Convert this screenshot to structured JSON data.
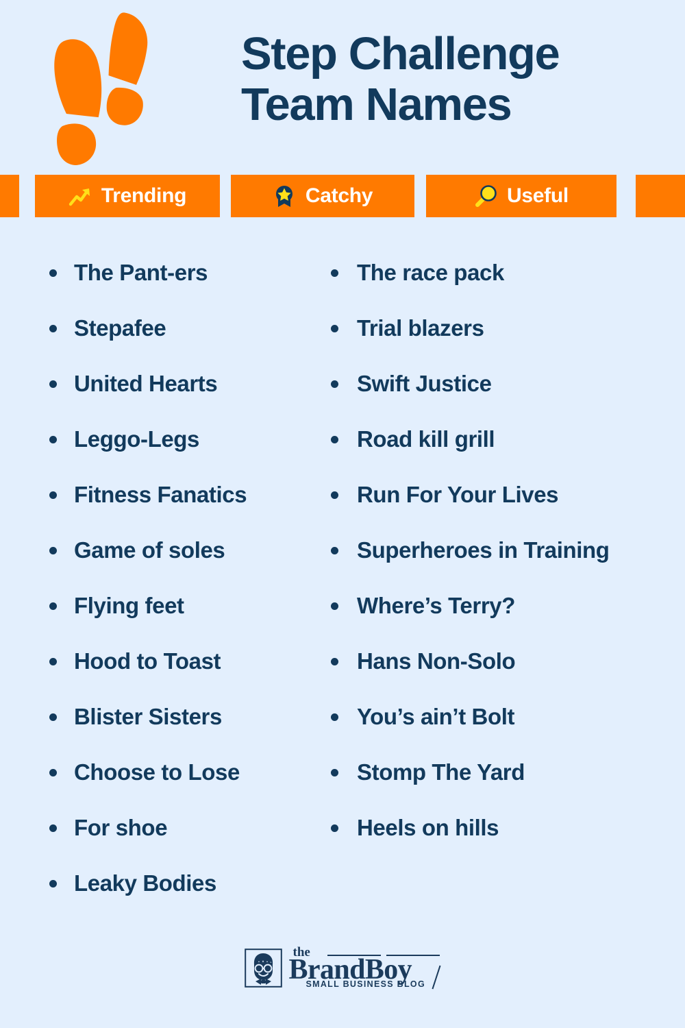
{
  "theme": {
    "background": "#e3effd",
    "navy": "#123a5c",
    "orange": "#ff7a00",
    "yellow": "#ffe01a",
    "white": "#ffffff",
    "logo_navy": "#1b3b5c"
  },
  "header": {
    "title_line1": "Step Challenge",
    "title_line2": "Team Names",
    "footprints_icon": "footprints-icon"
  },
  "badges": [
    {
      "label": "Trending",
      "icon": "trending-up-icon"
    },
    {
      "label": "Catchy",
      "icon": "award-ribbon-star-icon"
    },
    {
      "label": "Useful",
      "icon": "magnifying-glass-icon"
    }
  ],
  "list": {
    "left_column": [
      "The Pant-ers",
      "Stepafee",
      "United Hearts",
      "Leggo-Legs",
      "Fitness Fanatics",
      "Game of soles",
      "Flying feet",
      "Hood to Toast",
      "Blister Sisters",
      "Choose to Lose",
      "For shoe",
      "Leaky Bodies"
    ],
    "right_column": [
      "The race pack",
      "Trial blazers",
      "Swift Justice",
      "Road kill grill",
      "Run For Your Lives",
      "Superheroes in Training",
      "Where’s Terry?",
      "Hans Non-Solo",
      "You’s ain’t Bolt",
      "Stomp The Yard",
      "Heels on hills"
    ]
  },
  "footer": {
    "logo_the": "the",
    "logo_brand": "BrandBoy",
    "logo_tagline": "SMALL BUSINESS BLOG",
    "logo_mark_icon": "boy-with-glasses-icon"
  }
}
